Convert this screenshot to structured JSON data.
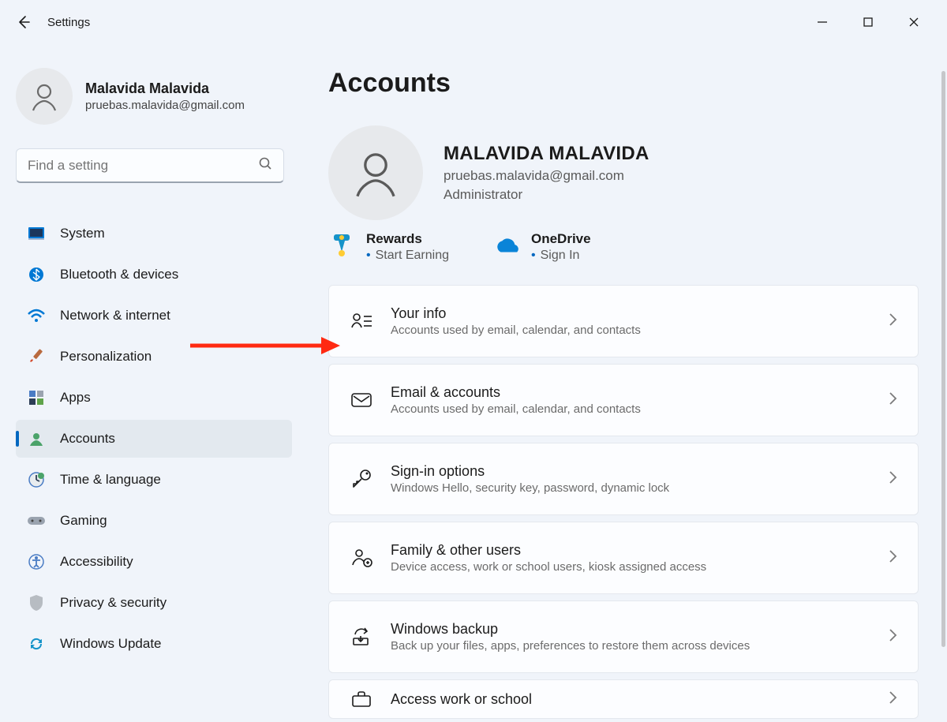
{
  "app_title": "Settings",
  "page_title": "Accounts",
  "user": {
    "name": "Malavida Malavida",
    "email": "pruebas.malavida@gmail.com"
  },
  "search": {
    "placeholder": "Find a setting"
  },
  "sidebar": {
    "items": [
      {
        "label": "System",
        "icon": "system"
      },
      {
        "label": "Bluetooth & devices",
        "icon": "bluetooth"
      },
      {
        "label": "Network & internet",
        "icon": "network"
      },
      {
        "label": "Personalization",
        "icon": "personalization"
      },
      {
        "label": "Apps",
        "icon": "apps"
      },
      {
        "label": "Accounts",
        "icon": "accounts",
        "active": true
      },
      {
        "label": "Time & language",
        "icon": "time"
      },
      {
        "label": "Gaming",
        "icon": "gaming"
      },
      {
        "label": "Accessibility",
        "icon": "accessibility"
      },
      {
        "label": "Privacy & security",
        "icon": "privacy"
      },
      {
        "label": "Windows Update",
        "icon": "update"
      }
    ]
  },
  "profile": {
    "display_name": "MALAVIDA MALAVIDA",
    "email": "pruebas.malavida@gmail.com",
    "role": "Administrator"
  },
  "quick_tiles": [
    {
      "title": "Rewards",
      "subtitle": "Start Earning",
      "icon": "rewards"
    },
    {
      "title": "OneDrive",
      "subtitle": "Sign In",
      "icon": "onedrive"
    }
  ],
  "settings_cards": [
    {
      "title": "Your info",
      "subtitle": "Accounts used by email, calendar, and contacts",
      "icon": "yourinfo"
    },
    {
      "title": "Email & accounts",
      "subtitle": "Accounts used by email, calendar, and contacts",
      "icon": "email"
    },
    {
      "title": "Sign-in options",
      "subtitle": "Windows Hello, security key, password, dynamic lock",
      "icon": "key"
    },
    {
      "title": "Family & other users",
      "subtitle": "Device access, work or school users, kiosk assigned access",
      "icon": "family"
    },
    {
      "title": "Windows backup",
      "subtitle": "Back up your files, apps, preferences to restore them across devices",
      "icon": "backup"
    },
    {
      "title": "Access work or school",
      "subtitle": "",
      "icon": "briefcase"
    }
  ]
}
